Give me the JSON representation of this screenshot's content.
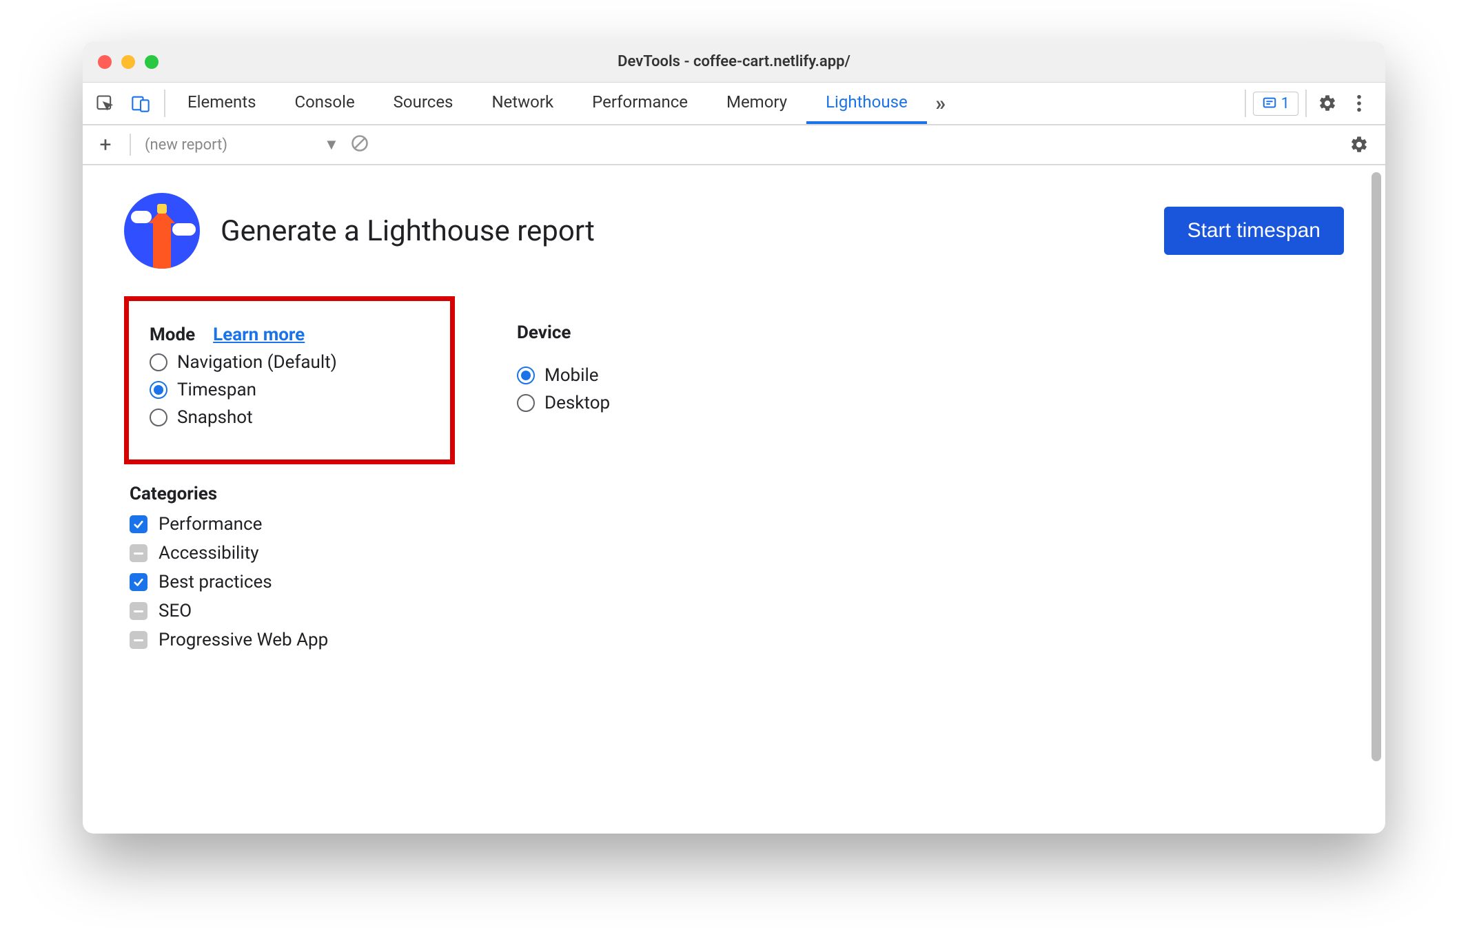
{
  "window_title": "DevTools - coffee-cart.netlify.app/",
  "tabs": {
    "items": [
      "Elements",
      "Console",
      "Sources",
      "Network",
      "Performance",
      "Memory",
      "Lighthouse"
    ],
    "active": "Lighthouse",
    "issue_count": "1"
  },
  "subbar": {
    "report_label": "(new report)"
  },
  "page_header": {
    "title": "Generate a Lighthouse report",
    "primary_button": "Start timespan"
  },
  "mode": {
    "label": "Mode",
    "learn_more": "Learn more",
    "options": [
      "Navigation (Default)",
      "Timespan",
      "Snapshot"
    ],
    "selected": "Timespan"
  },
  "device": {
    "label": "Device",
    "options": [
      "Mobile",
      "Desktop"
    ],
    "selected": "Mobile"
  },
  "categories": {
    "label": "Categories",
    "items": [
      {
        "label": "Performance",
        "state": "checked"
      },
      {
        "label": "Accessibility",
        "state": "indeterminate"
      },
      {
        "label": "Best practices",
        "state": "checked"
      },
      {
        "label": "SEO",
        "state": "indeterminate"
      },
      {
        "label": "Progressive Web App",
        "state": "indeterminate"
      }
    ]
  },
  "highlight": {
    "target": "mode-section"
  }
}
